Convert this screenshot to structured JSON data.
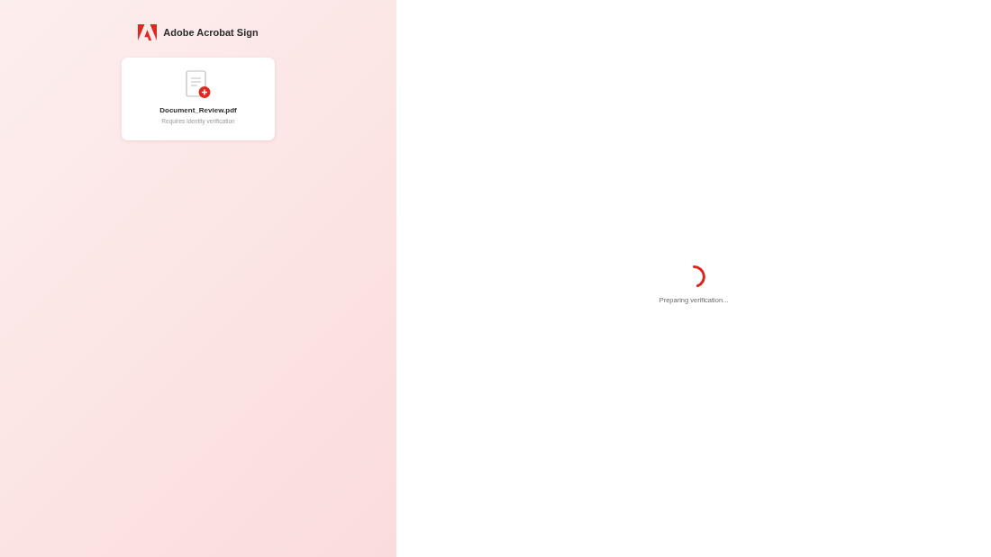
{
  "brand": {
    "name": "Adobe Acrobat Sign"
  },
  "document": {
    "filename": "Document_Review.pdf",
    "status": "Requires identity verification"
  },
  "loader": {
    "message": "Preparing verification..."
  }
}
